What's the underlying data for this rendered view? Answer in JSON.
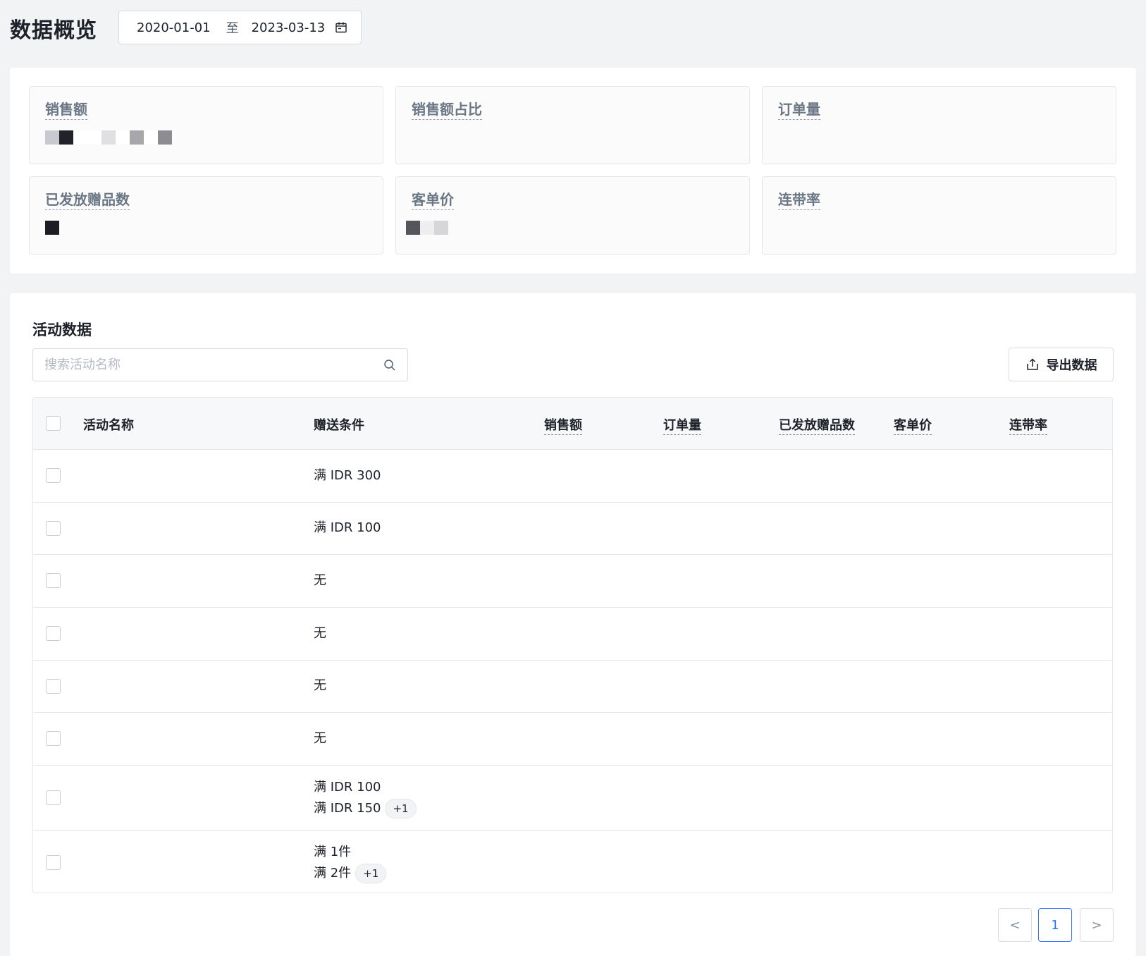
{
  "header": {
    "title": "数据概览",
    "date_start": "2020-01-01",
    "date_separator": "至",
    "date_end": "2023-03-13"
  },
  "overview": {
    "metrics": [
      {
        "label": "销售额"
      },
      {
        "label": "销售额占比"
      },
      {
        "label": "订单量"
      },
      {
        "label": "已发放赠品数"
      },
      {
        "label": "客单价"
      },
      {
        "label": "连带率"
      }
    ]
  },
  "activity": {
    "title": "活动数据",
    "search_placeholder": "搜索活动名称",
    "export_label": "导出数据",
    "columns": [
      "活动名称",
      "赠送条件",
      "销售额",
      "订单量",
      "已发放赠品数",
      "客单价",
      "连带率"
    ],
    "rows": [
      {
        "conditions": [
          "满 IDR 300"
        ],
        "more": ""
      },
      {
        "conditions": [
          "满 IDR 100"
        ],
        "more": ""
      },
      {
        "conditions": [
          "无"
        ],
        "more": ""
      },
      {
        "conditions": [
          "无"
        ],
        "more": ""
      },
      {
        "conditions": [
          "无"
        ],
        "more": ""
      },
      {
        "conditions": [
          "无"
        ],
        "more": ""
      },
      {
        "conditions": [
          "满 IDR 100",
          "满 IDR 150"
        ],
        "more": "+1"
      },
      {
        "conditions": [
          "满 1件",
          "满 2件"
        ],
        "more": "+1"
      }
    ]
  },
  "pagination": {
    "prev": "<",
    "current": "1",
    "next": ">"
  },
  "colors": {
    "accent": "#3370ff",
    "background": "#f2f3f5"
  }
}
